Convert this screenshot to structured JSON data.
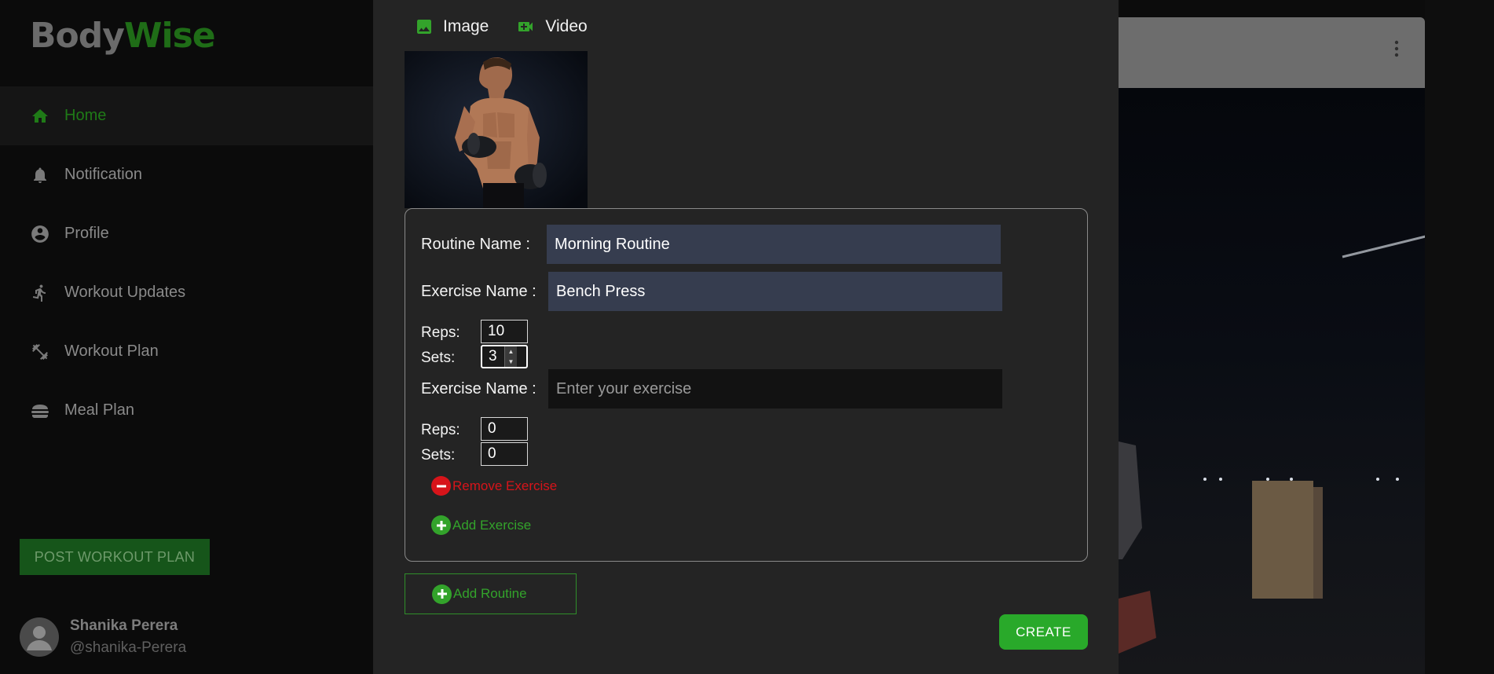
{
  "app": {
    "logo_part1": "Body",
    "logo_part2": "Wise"
  },
  "sidebar": {
    "items": [
      {
        "label": "Home",
        "icon": "home-icon",
        "active": true
      },
      {
        "label": "Notification",
        "icon": "bell-icon"
      },
      {
        "label": "Profile",
        "icon": "account-circle-icon"
      },
      {
        "label": "Workout Updates",
        "icon": "running-icon"
      },
      {
        "label": "Workout Plan",
        "icon": "dumbbell-icon"
      },
      {
        "label": "Meal Plan",
        "icon": "burger-icon"
      }
    ],
    "post_button": "POST WORKOUT PLAN",
    "user": {
      "name": "Shanika Perera",
      "handle": "@shanika-Perera"
    }
  },
  "modal": {
    "media": {
      "image_label": "Image",
      "video_label": "Video"
    },
    "routine": {
      "routine_label": "Routine Name :",
      "routine_value": "Morning Routine",
      "exercises": [
        {
          "label": "Exercise Name :",
          "value": "Bench Press",
          "reps_label": "Reps:",
          "reps": "10",
          "sets_label": "Sets:",
          "sets": "3"
        },
        {
          "label": "Exercise Name :",
          "value": "",
          "placeholder": "Enter your exercise",
          "reps_label": "Reps:",
          "reps": "0",
          "sets_label": "Sets:",
          "sets": "0"
        }
      ],
      "remove_exercise": "Remove Exercise",
      "add_exercise": "Add Exercise"
    },
    "add_routine": "Add Routine",
    "create": "CREATE"
  },
  "colors": {
    "accent_green": "#33a32b",
    "danger_red": "#d7141a",
    "modal_bg": "#242424",
    "input_bg": "#363d4f"
  }
}
